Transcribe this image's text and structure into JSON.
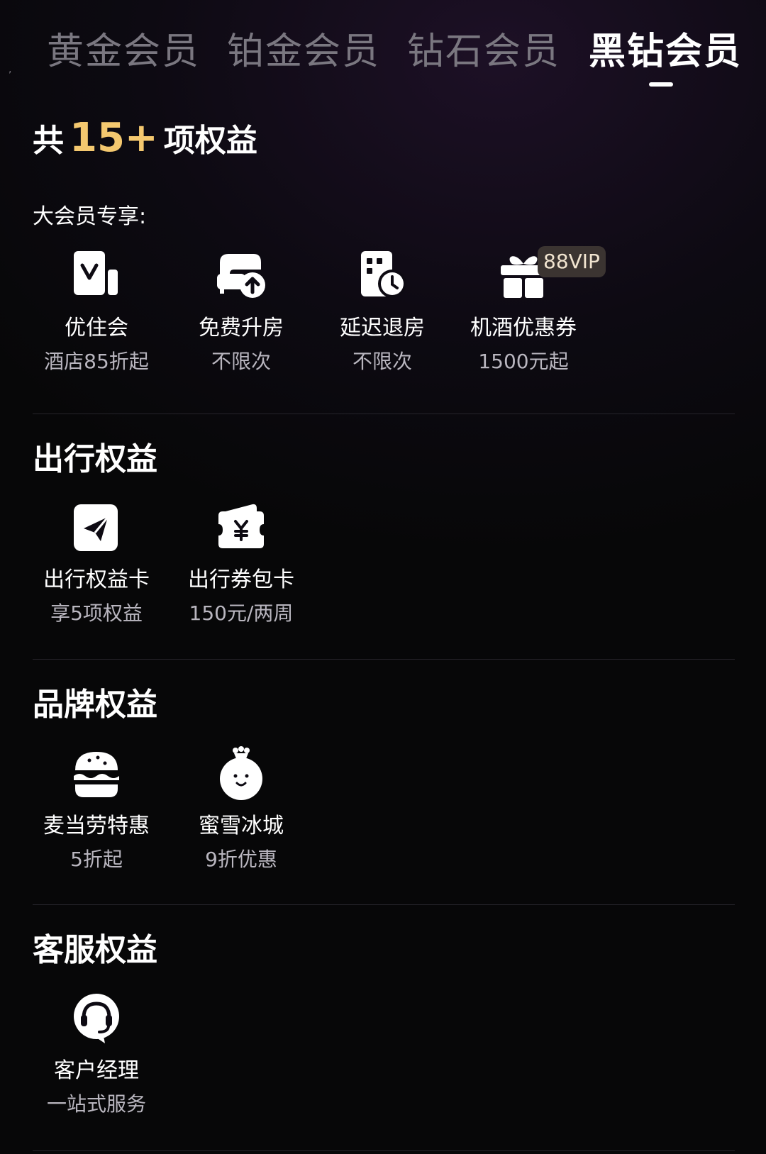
{
  "tabs": [
    {
      "label": "黄金会员"
    },
    {
      "label": "铂金会员"
    },
    {
      "label": "钻石会员"
    },
    {
      "label": "黑钻会员",
      "active": true
    }
  ],
  "summary": {
    "prefix": "共",
    "count": "15+",
    "suffix": "项权益"
  },
  "exclusive": {
    "label": "大会员专享:",
    "badge": "88VIP",
    "items": [
      {
        "name": "优住会",
        "desc": "酒店85折起",
        "icon": "v-card-icon"
      },
      {
        "name": "免费升房",
        "desc": "不限次",
        "icon": "room-upgrade-icon"
      },
      {
        "name": "延迟退房",
        "desc": "不限次",
        "icon": "late-checkout-icon"
      },
      {
        "name": "机酒优惠券",
        "desc": "1500元起",
        "icon": "gift-icon"
      }
    ]
  },
  "travel": {
    "title": "出行权益",
    "items": [
      {
        "name": "出行权益卡",
        "desc": "享5项权益",
        "icon": "paper-plane-icon"
      },
      {
        "name": "出行券包卡",
        "desc": "150元/两周",
        "icon": "coupon-wallet-icon"
      }
    ]
  },
  "brand": {
    "title": "品牌权益",
    "items": [
      {
        "name": "麦当劳特惠",
        "desc": "5折起",
        "icon": "burger-icon"
      },
      {
        "name": "蜜雪冰城",
        "desc": "9折优惠",
        "icon": "snowman-icon"
      }
    ]
  },
  "service": {
    "title": "客服权益",
    "items": [
      {
        "name": "客户经理",
        "desc": "一站式服务",
        "icon": "headset-icon"
      }
    ]
  },
  "colors": {
    "accent": "#f4c86f",
    "background": "#0d0a12",
    "muted_text": "#b9b6bf",
    "inactive_tab": "#7a7780"
  }
}
